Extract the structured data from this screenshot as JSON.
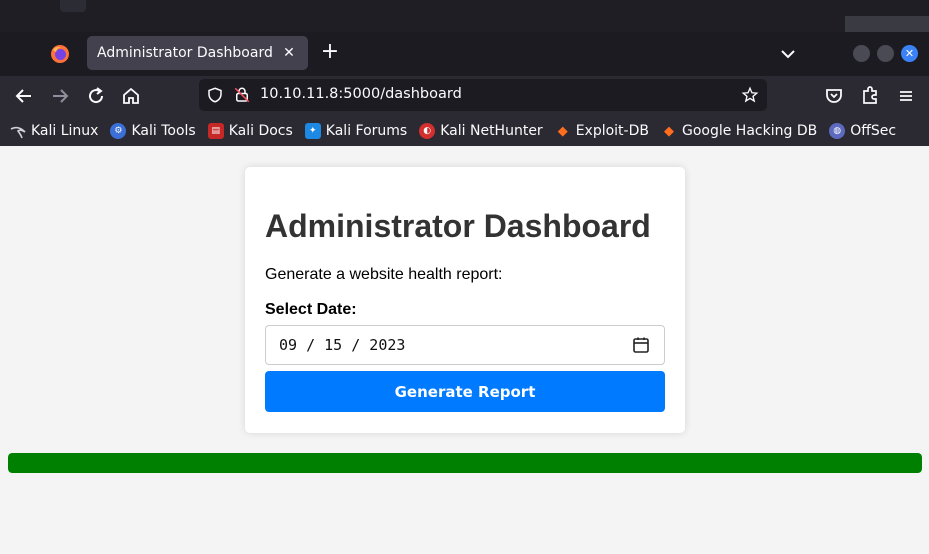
{
  "browser": {
    "tab_title": "Administrator Dashboard",
    "url": "10.10.11.8:5000/dashboard",
    "bookmarks": [
      {
        "label": "Kali Linux",
        "icon": "kali-dragon-icon",
        "color": "#1a1a1a"
      },
      {
        "label": "Kali Tools",
        "icon": "kali-tools-icon",
        "color": "#3b6fd8"
      },
      {
        "label": "Kali Docs",
        "icon": "kali-docs-icon",
        "color": "#c62828"
      },
      {
        "label": "Kali Forums",
        "icon": "kali-forums-icon",
        "color": "#1e88e5"
      },
      {
        "label": "Kali NetHunter",
        "icon": "kali-nethunter-icon",
        "color": "#d32f2f"
      },
      {
        "label": "Exploit-DB",
        "icon": "exploit-db-icon",
        "color": "#e65100"
      },
      {
        "label": "Google Hacking DB",
        "icon": "ghdb-icon",
        "color": "#e65100"
      },
      {
        "label": "OffSec",
        "icon": "offsec-icon",
        "color": "#5c6bc0"
      }
    ]
  },
  "dashboard": {
    "title": "Administrator Dashboard",
    "description": "Generate a website health report:",
    "date_label": "Select Date:",
    "date_value": "09 / 15 / 2023",
    "button_label": "Generate Report",
    "progress_percent": 100,
    "button_color": "#007bff",
    "progress_color": "#008000"
  }
}
